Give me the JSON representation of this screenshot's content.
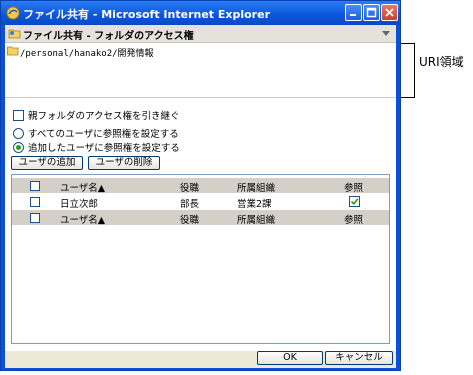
{
  "window": {
    "title": "ファイル共有 - Microsoft Internet Explorer",
    "title_icon": "ie-icon"
  },
  "header": {
    "title": "ファイル共有 - フォルダのアクセス権"
  },
  "uri": {
    "path": "/personal/hanako2/開発情報"
  },
  "annotation": {
    "label": "URI領域"
  },
  "options": {
    "inherit_label": "親フォルダのアクセス権を引き継ぐ",
    "inherit_checked": false,
    "radio_all_label": "すべてのユーザに参照権を設定する",
    "radio_added_label": "追加したユーザに参照権を設定する",
    "selected_radio": "added"
  },
  "buttons": {
    "add_user": "ユーザの追加",
    "remove_user": "ユーザの削除",
    "ok": "OK",
    "cancel": "キャンセル"
  },
  "table": {
    "columns": {
      "name": "ユーザ名▲",
      "role": "役職",
      "dept": "所属組織",
      "ref": "参照"
    },
    "rows": [
      {
        "name": "日立次郎",
        "role": "部長",
        "dept": "営業2課",
        "ref": true
      }
    ]
  }
}
